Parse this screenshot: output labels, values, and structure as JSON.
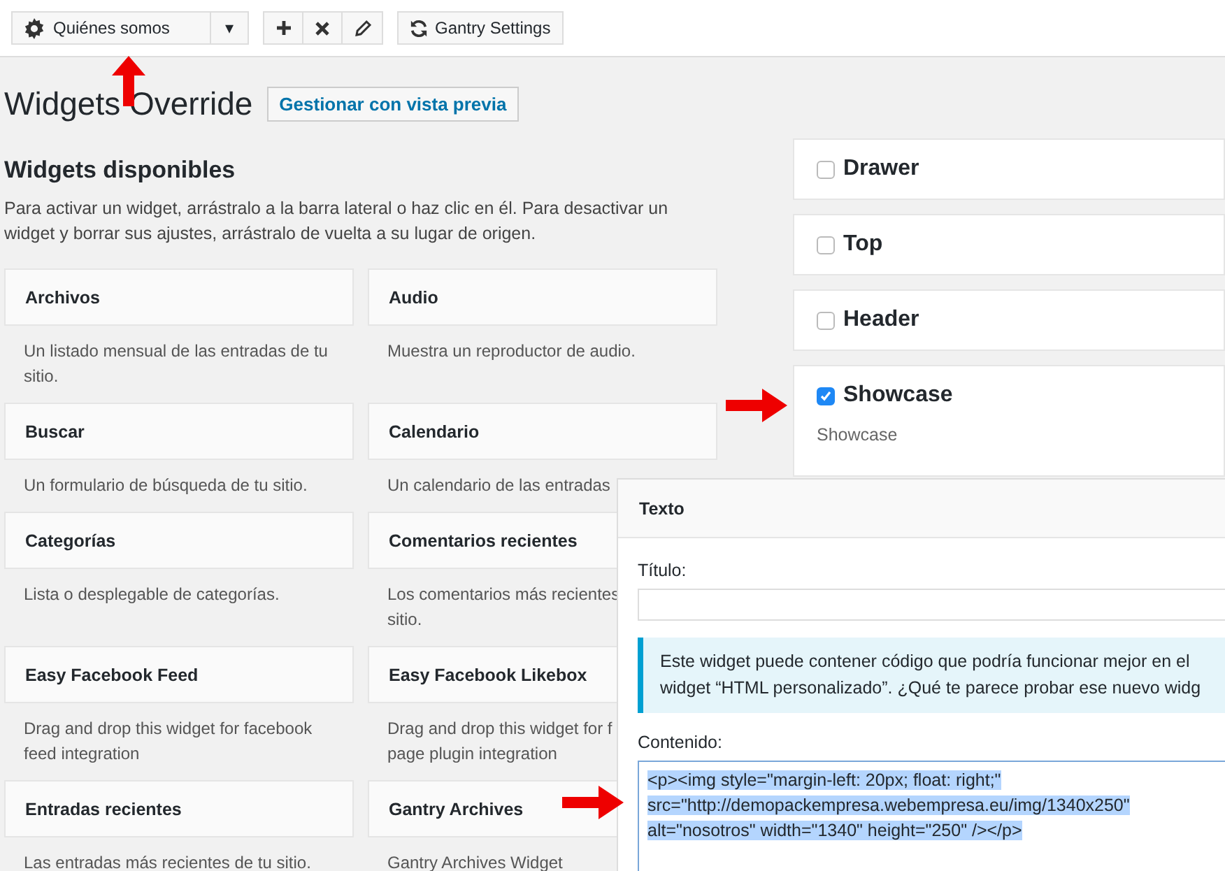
{
  "toolbar": {
    "outline": {
      "value": "Quiénes somos",
      "caret": "▾"
    },
    "actions": [
      {
        "kind": "add"
      },
      {
        "kind": "delete"
      },
      {
        "kind": "edit"
      }
    ],
    "settings_button": "Gantry Settings"
  },
  "page": {
    "title": "Widgets Override",
    "preview_button": "Gestionar con vista previa"
  },
  "available": {
    "heading": "Widgets disponibles",
    "intro": "Para activar un widget, arrástralo a la barra lateral o haz clic en él. Para desactivar un widget y borrar sus ajustes, arrástralo de vuelta a su lugar de origen.",
    "widgets": [
      {
        "name": "Archivos",
        "description": [
          "Un listado mensual de las entradas de tu",
          "sitio."
        ]
      },
      {
        "name": "Audio",
        "description": [
          "Muestra un reproductor de audio."
        ]
      },
      {
        "name": "Buscar",
        "description": [
          "Un formulario de búsqueda de tu sitio."
        ]
      },
      {
        "name": "Calendario",
        "description": [
          "Un calendario de las entradas"
        ]
      },
      {
        "name": "Categorías",
        "description": [
          "Lista o desplegable de categorías."
        ]
      },
      {
        "name": "Comentarios recientes",
        "description": [
          "Los comentarios más recientes",
          "sitio."
        ]
      },
      {
        "name": "Easy Facebook Feed",
        "description": [
          "Drag and drop this widget for facebook",
          "feed integration"
        ]
      },
      {
        "name": "Easy Facebook Likebox",
        "description": [
          "Drag and drop this widget for f",
          "page plugin integration"
        ]
      },
      {
        "name": "Entradas recientes",
        "description": [
          "Las entradas más recientes de tu sitio."
        ]
      },
      {
        "name": "Gantry Archives",
        "description": [
          "Gantry Archives Widget"
        ]
      }
    ]
  },
  "sidebars": [
    {
      "name": "Drawer",
      "checked": false
    },
    {
      "name": "Top",
      "checked": false
    },
    {
      "name": "Header",
      "checked": false
    },
    {
      "name": "Showcase",
      "checked": true,
      "subtitle": "Showcase"
    }
  ],
  "editor": {
    "title": "Texto",
    "title_label": "Título:",
    "notice": [
      "Este widget puede contener código que podría funcionar mejor en el",
      "widget “HTML personalizado”. ¿Qué te parece probar ese nuevo widg"
    ],
    "content_label": "Contenido:",
    "content": [
      "<p><img style=\"margin-left: 20px; float: right;\"",
      "src=\"http://demopackempresa.webempresa.eu/img/1340x250\"",
      "alt=\"nosotros\" width=\"1340\" height=\"250\" /></p>"
    ]
  }
}
